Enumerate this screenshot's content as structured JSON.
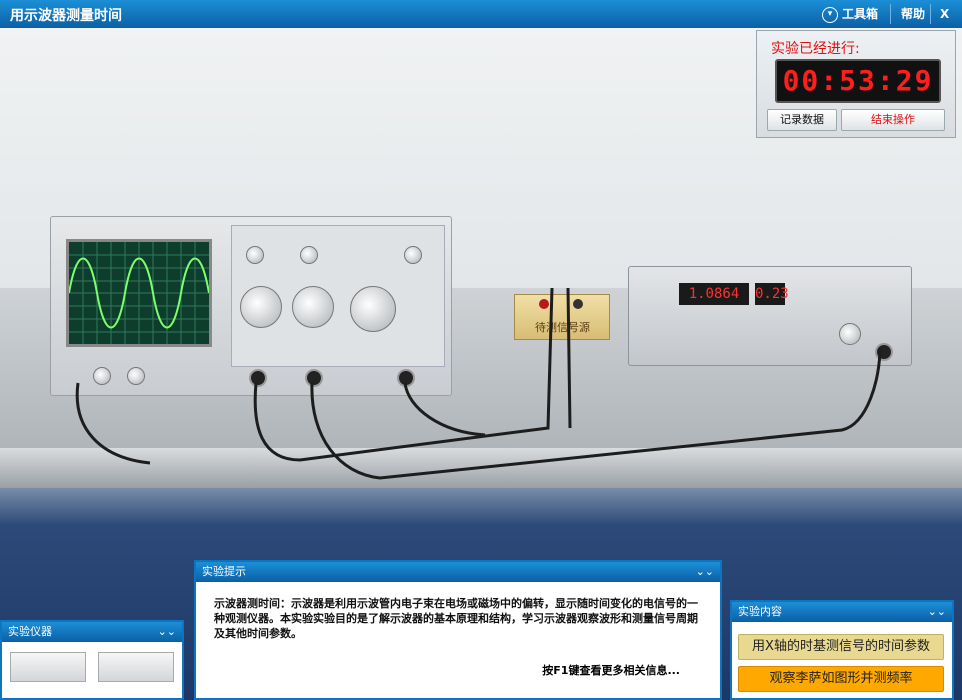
{
  "window": {
    "title": "用示波器测量时间",
    "toolbox_label": "工具箱",
    "help_label": "帮助",
    "close_label": "X"
  },
  "timer": {
    "label": "实验已经进行:",
    "time": "00:53:29",
    "record_label": "记录数据",
    "end_label": "结束操作"
  },
  "signal_source_label": "待测信号源",
  "generator": {
    "freq_display": "1.0864",
    "level_display": "0.23"
  },
  "tips_panel": {
    "title": "实验提示",
    "text": "示波器测时间：示波器是利用示波管内电子束在电场或磁场中的偏转，显示随时间变化的电信号的一种观测仪器。本实验实验目的是了解示波器的基本原理和结构，学习示波器观察波形和测量信号周期及其他时间参数。",
    "more": "按F1键查看更多相关信息..."
  },
  "instruments_panel": {
    "title": "实验仪器"
  },
  "content_panel": {
    "title": "实验内容",
    "items": [
      "用X轴的时基测信号的时间参数",
      "观察李萨如图形并测频率"
    ]
  },
  "colors": {
    "accent": "#0b5fa5",
    "item_active": "#ffa900",
    "item_normal": "#e9d890",
    "timer_digits": "#ff1e1e"
  }
}
